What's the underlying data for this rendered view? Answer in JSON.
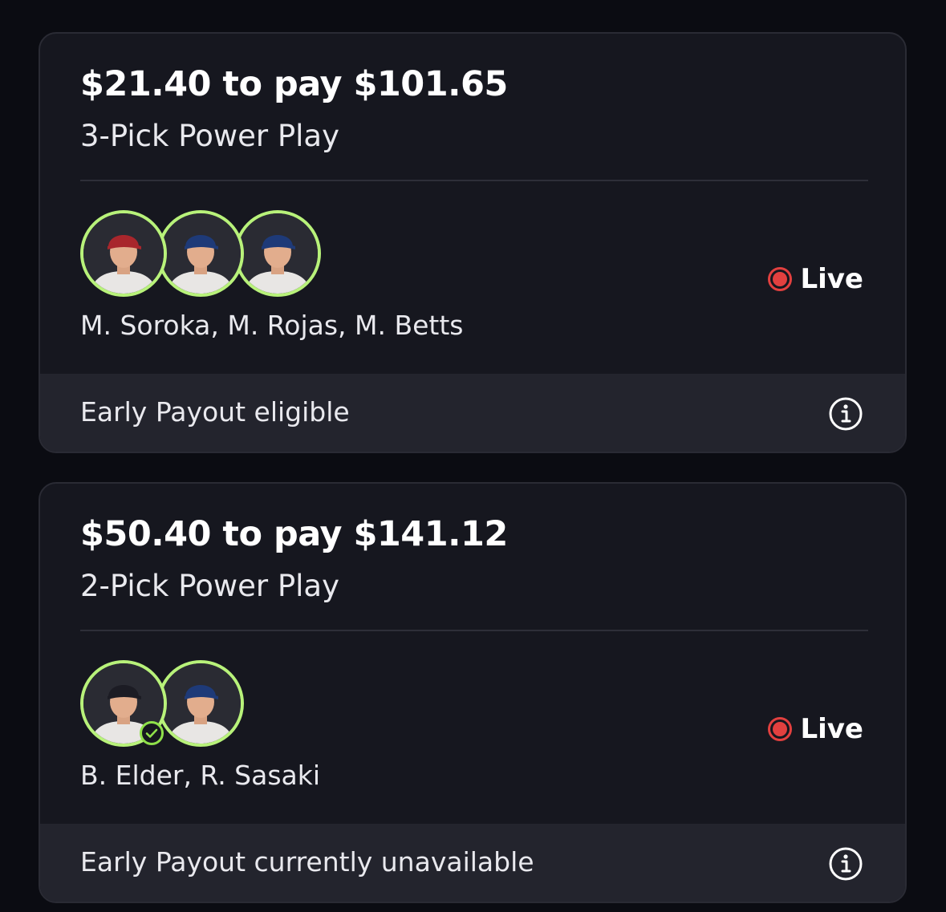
{
  "entries": [
    {
      "title": "$21.40 to pay $101.65",
      "subtitle": "3-Pick Power Play",
      "status": "Live",
      "players": "M. Soroka, M. Rojas, M. Betts",
      "footer": "Early Payout eligible",
      "avatars": [
        {
          "name": "M. Soroka",
          "cap_color": "#a8262c",
          "jersey_color": "#e8e6e4",
          "check": false
        },
        {
          "name": "M. Rojas",
          "cap_color": "#1e3a78",
          "jersey_color": "#e8e6e4",
          "check": false
        },
        {
          "name": "M. Betts",
          "cap_color": "#1e3a78",
          "jersey_color": "#e8e6e4",
          "check": false
        }
      ]
    },
    {
      "title": "$50.40 to pay $141.12",
      "subtitle": "2-Pick Power Play",
      "status": "Live",
      "players": "B. Elder, R. Sasaki",
      "footer": "Early Payout currently unavailable",
      "avatars": [
        {
          "name": "B. Elder",
          "cap_color": "#1c1c24",
          "jersey_color": "#e8e6e4",
          "check": true
        },
        {
          "name": "R. Sasaki",
          "cap_color": "#1e3a78",
          "jersey_color": "#e8e6e4",
          "check": false
        }
      ]
    }
  ],
  "colors": {
    "ring": "#b8f27a",
    "live": "#e2403f",
    "card": "#16171f",
    "footer": "#23242d"
  }
}
